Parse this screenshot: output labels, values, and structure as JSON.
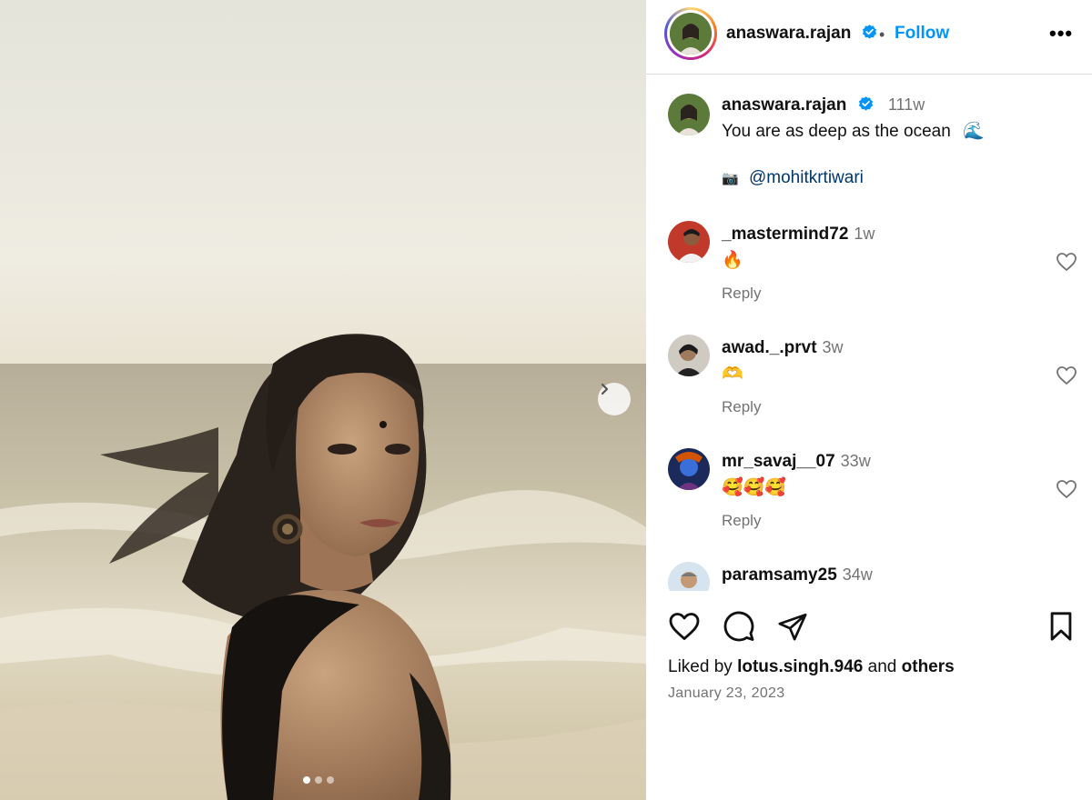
{
  "post": {
    "username": "anaswara.rajan",
    "verified": true,
    "separator": "•",
    "follow_label": "Follow",
    "more_label": "•••",
    "caption": {
      "username": "anaswara.rajan",
      "time": "111w",
      "text": "You are as deep as the ocean",
      "emoji": "🌊",
      "credit_emoji": "📷",
      "credit_mention": "@mohitkrtiwari"
    },
    "carousel": {
      "current_index": 1,
      "count": 3
    }
  },
  "comments": [
    {
      "username": "_mastermind72",
      "time": "1w",
      "text": "🔥",
      "reply_label": "Reply"
    },
    {
      "username": "awad._.prvt",
      "time": "3w",
      "text": "🫶",
      "reply_label": "Reply"
    },
    {
      "username": "mr_savaj__07",
      "time": "33w",
      "text": "🥰🥰🥰",
      "reply_label": "Reply"
    },
    {
      "username": "paramsamy25",
      "time": "34w",
      "text": "",
      "reply_label": ""
    }
  ],
  "footer": {
    "liked_prefix": "Liked by",
    "liked_user": "lotus.singh.946",
    "liked_mid": "and",
    "liked_suffix": "others",
    "date": "January 23, 2023"
  },
  "icons": {
    "like": "heart-icon",
    "comment": "comment-icon",
    "share": "share-icon",
    "save": "bookmark-icon",
    "next": "chevron-right-icon",
    "verified": "verified-badge-icon"
  },
  "colors": {
    "follow": "#0095f6",
    "verified": "#0095f6",
    "muted": "#737373",
    "mention": "#00376b"
  }
}
